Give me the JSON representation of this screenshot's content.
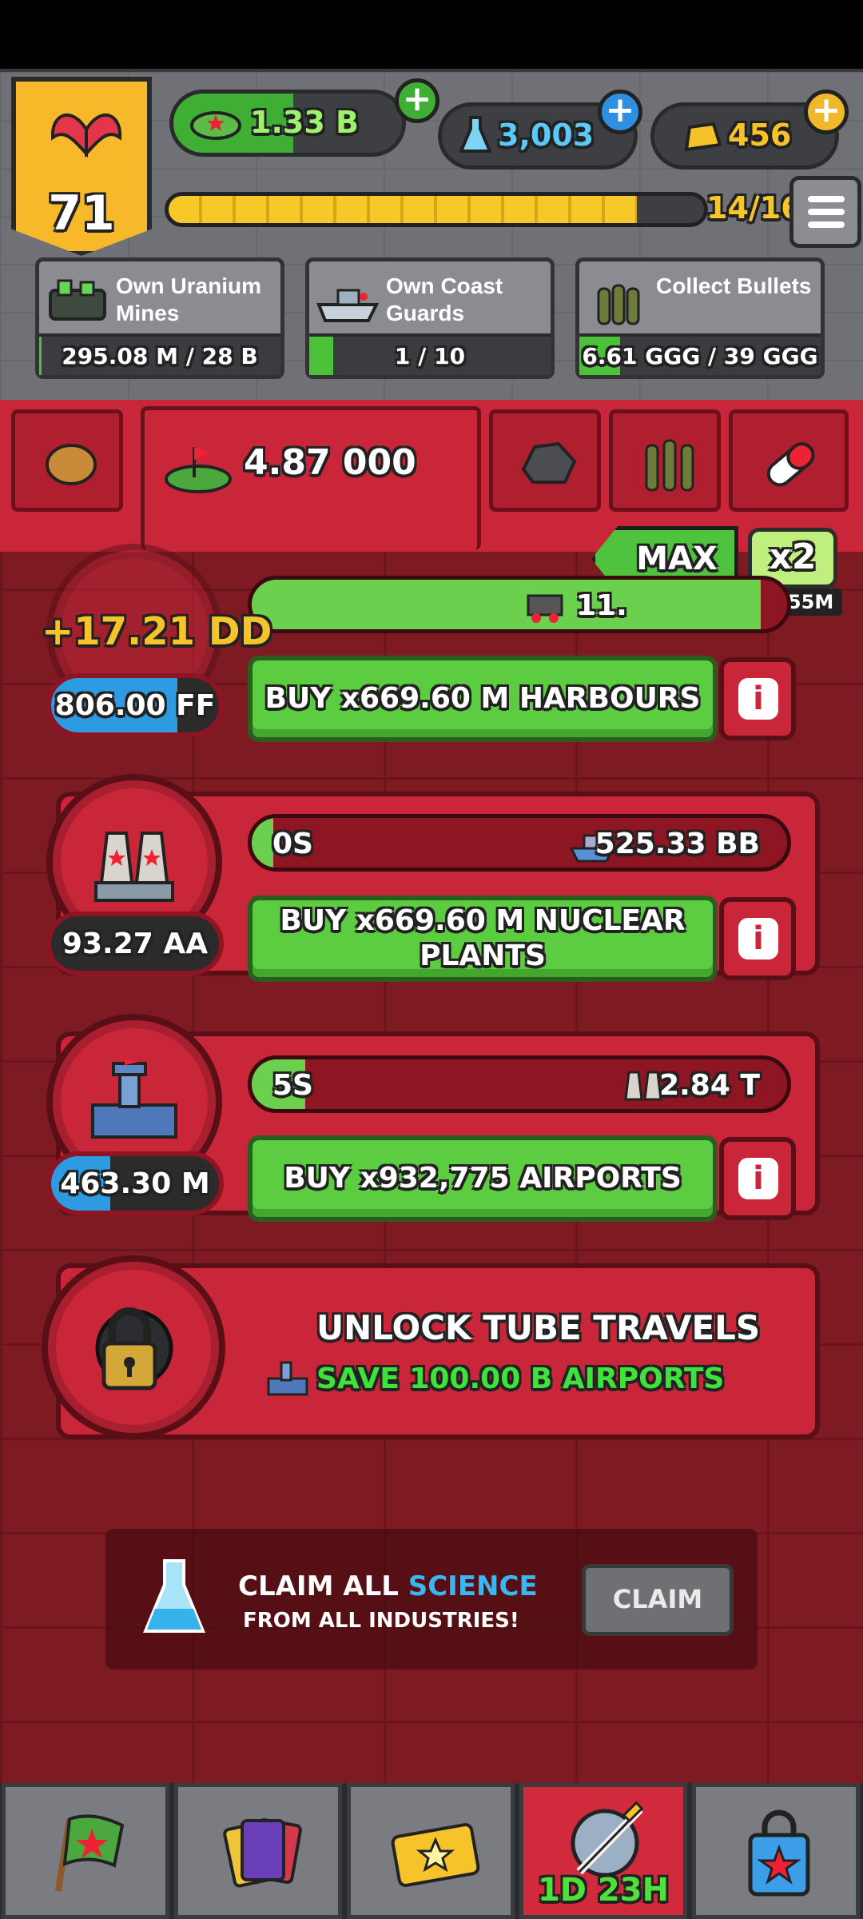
{
  "header": {
    "level": "71",
    "cash": "1.33 B",
    "science": "3,003",
    "gold": "456",
    "xp_progress": "14/16",
    "xp_fraction": 0.875
  },
  "missions": [
    {
      "label": "Own Uranium Mines",
      "progress": "295.08 M / 28 B",
      "fraction": 0.01
    },
    {
      "label": "Own Coast Guards",
      "progress": "1 / 10",
      "fraction": 0.1
    },
    {
      "label": "Collect Bullets",
      "progress": "6.61 GGG / 39 GGG",
      "fraction": 0.17
    }
  ],
  "tabs": {
    "active_value": "4.87 000"
  },
  "boost": {
    "max_label": "MAX",
    "x2_label": "x2",
    "x2_timer": "2H 55M"
  },
  "industries": [
    {
      "name": "harbours",
      "floating": "+17.21 DD",
      "count": "806.00 FF",
      "count_fraction": 0.75,
      "time": "",
      "earn": "11.",
      "bar_fraction": 0.95,
      "buy_label": "BUY x669.60 M HARBOURS"
    },
    {
      "name": "nuclear-plants",
      "count": "93.27 AA",
      "count_fraction": 0,
      "time": "0S",
      "earn": "525.33 BB",
      "bar_fraction": 0.04,
      "buy_label": "BUY x669.60 M NUCLEAR PLANTS"
    },
    {
      "name": "airports",
      "count": "463.30 M",
      "count_fraction": 0.35,
      "time": "5S",
      "earn": "2.84 T",
      "bar_fraction": 0.1,
      "buy_label": "BUY x932,775 AIRPORTS"
    }
  ],
  "unlock": {
    "title": "UNLOCK TUBE TRAVELS",
    "requirement": "SAVE 100.00 B AIRPORTS"
  },
  "claim": {
    "prefix": "CLAIM ALL ",
    "highlight": "SCIENCE",
    "line2": "FROM ALL INDUSTRIES!",
    "button": "CLAIM"
  },
  "nav": {
    "event_timer": "1D 23H"
  },
  "colors": {
    "accent_red": "#c9263a",
    "green": "#5ccc40",
    "gold": "#f7b82a",
    "science_blue": "#3ab6f0"
  }
}
